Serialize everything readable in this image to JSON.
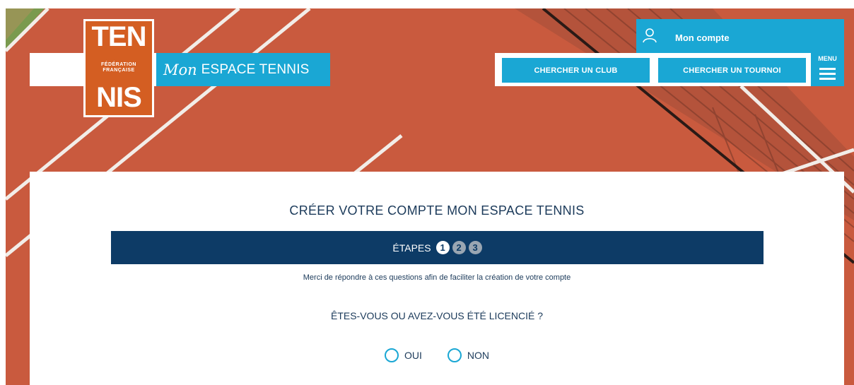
{
  "header": {
    "logo": {
      "top": "TEN",
      "middle": "FÉDÉRATION FRANÇAISE",
      "bottom": "NIS"
    },
    "brand": {
      "mon": "Mon",
      "title": "ESPACE TENNIS"
    },
    "account_label": "Mon compte",
    "buttons": {
      "club": "CHERCHER UN CLUB",
      "tournoi": "CHERCHER UN TOURNOI"
    },
    "menu_label": "MENU"
  },
  "form": {
    "title": "CRÉER VOTRE COMPTE MON ESPACE TENNIS",
    "steps": {
      "label": "ÉTAPES",
      "items": [
        "1",
        "2",
        "3"
      ],
      "active": 1
    },
    "intro": "Merci de répondre à ces questions afin de faciliter la création de votre compte",
    "question": "ÊTES-VOUS OU AVEZ-VOUS ÉTÉ LICENCIÉ ?",
    "options": [
      "OUI",
      "NON"
    ]
  },
  "colors": {
    "accent": "#1aa7d4",
    "navy": "#0d3b66",
    "court": "#c95a3e",
    "logo": "#d45e22"
  },
  "icons": {
    "account": "user-icon",
    "menu": "hamburger-icon"
  }
}
